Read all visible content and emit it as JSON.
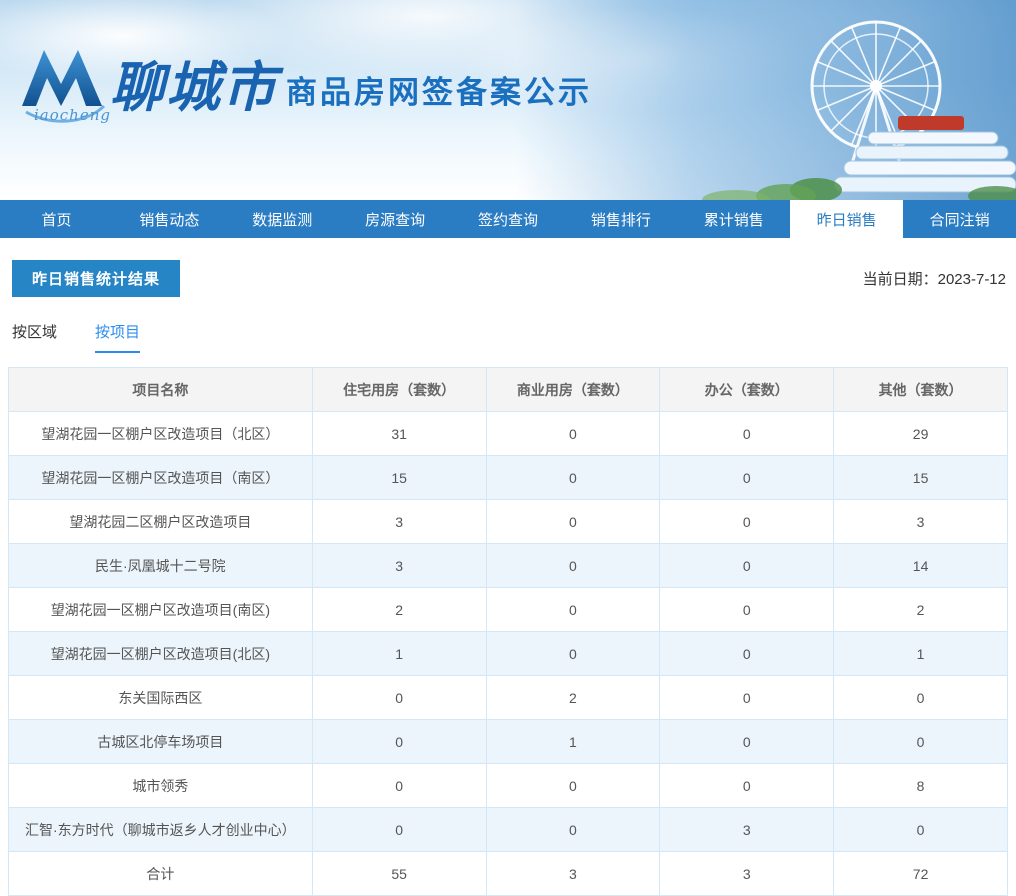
{
  "colors": {
    "nav_bg": "#2a7cc3",
    "accent_blue": "#2585c5",
    "tab_active": "#2d8cf0",
    "table_border": "#d3e7f6",
    "row_alt_bg": "#ecf5fc",
    "header_row_bg": "#f4f4f4"
  },
  "banner": {
    "logo_script": "iaocheng",
    "site_name": "聊城市",
    "site_subtitle": "商品房网签备案公示"
  },
  "nav": {
    "items": [
      {
        "label": "首页",
        "active": false
      },
      {
        "label": "销售动态",
        "active": false
      },
      {
        "label": "数据监测",
        "active": false
      },
      {
        "label": "房源查询",
        "active": false
      },
      {
        "label": "签约查询",
        "active": false
      },
      {
        "label": "销售排行",
        "active": false
      },
      {
        "label": "累计销售",
        "active": false
      },
      {
        "label": "昨日销售",
        "active": true
      },
      {
        "label": "合同注销",
        "active": false
      }
    ]
  },
  "page": {
    "title": "昨日销售统计结果",
    "date_text": "当前日期：2023-7-12"
  },
  "tabs": [
    {
      "label": "按区域",
      "active": false
    },
    {
      "label": "按项目",
      "active": true
    }
  ],
  "table": {
    "headers": [
      "项目名称",
      "住宅用房（套数）",
      "商业用房（套数）",
      "办公（套数）",
      "其他（套数）"
    ],
    "rows": [
      [
        "望湖花园一区棚户区改造项目（北区）",
        "31",
        "0",
        "0",
        "29"
      ],
      [
        "望湖花园一区棚户区改造项目（南区）",
        "15",
        "0",
        "0",
        "15"
      ],
      [
        "望湖花园二区棚户区改造项目",
        "3",
        "0",
        "0",
        "3"
      ],
      [
        "民生·凤凰城十二号院",
        "3",
        "0",
        "0",
        "14"
      ],
      [
        "望湖花园一区棚户区改造项目(南区)",
        "2",
        "0",
        "0",
        "2"
      ],
      [
        "望湖花园一区棚户区改造项目(北区)",
        "1",
        "0",
        "0",
        "1"
      ],
      [
        "东关国际西区",
        "0",
        "2",
        "0",
        "0"
      ],
      [
        "古城区北停车场项目",
        "0",
        "1",
        "0",
        "0"
      ],
      [
        "城市领秀",
        "0",
        "0",
        "0",
        "8"
      ],
      [
        "汇智·东方时代（聊城市返乡人才创业中心）",
        "0",
        "0",
        "3",
        "0"
      ],
      [
        "合计",
        "55",
        "3",
        "3",
        "72"
      ]
    ]
  }
}
